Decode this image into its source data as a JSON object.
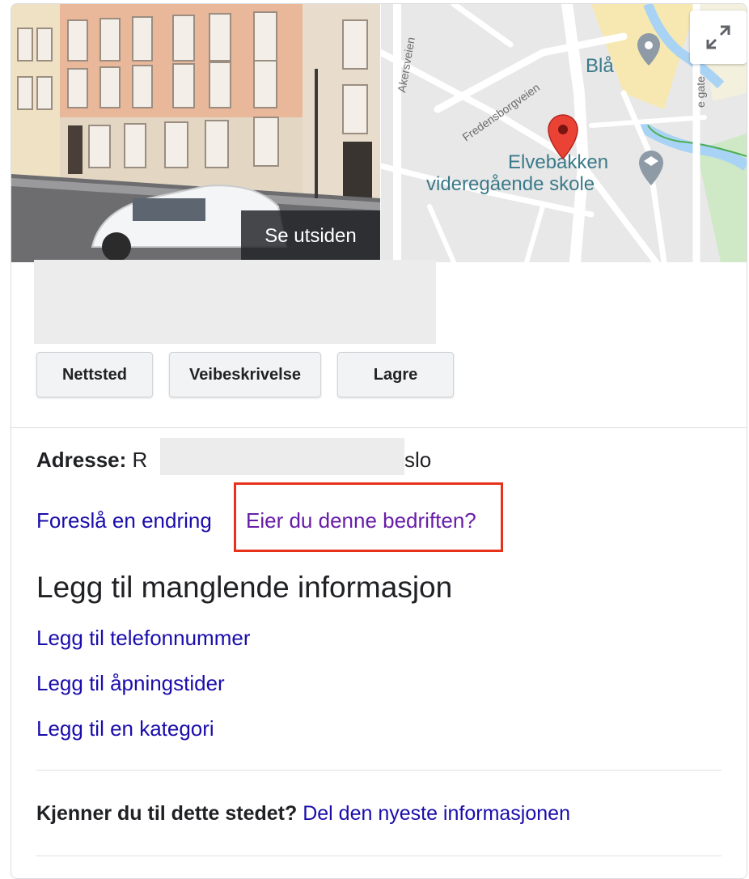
{
  "photo": {
    "overlay_label": "Se utsiden"
  },
  "map": {
    "street_labels": [
      "Akersveien",
      "Fredensborgveien",
      "e gate"
    ],
    "places": [
      {
        "name_line1": "Blå"
      },
      {
        "name_line1": "Elvebakken",
        "name_line2": "videregående skole"
      }
    ],
    "expand_icon": "expand-icon",
    "pin_color": "#ea4335",
    "water_color": "#a9d3f5"
  },
  "actions": [
    "Nettsted",
    "Veibeskrivelse",
    "Lagre"
  ],
  "address": {
    "label": "Adresse:",
    "visible_start": "R",
    "visible_end": "slo"
  },
  "links": {
    "suggest_edit": "Foreslå en endring",
    "own_business": "Eier du denne bedriften?"
  },
  "missing_info": {
    "title": "Legg til manglende informasjon",
    "items": [
      "Legg til telefonnummer",
      "Legg til åpningstider",
      "Legg til en kategori"
    ]
  },
  "know_place": {
    "question": "Kjenner du til dette stedet?",
    "link": "Del den nyeste informasjonen"
  },
  "colors": {
    "link": "#1a0dab",
    "visited_link": "#681da8",
    "highlight_border": "#e6321b"
  }
}
